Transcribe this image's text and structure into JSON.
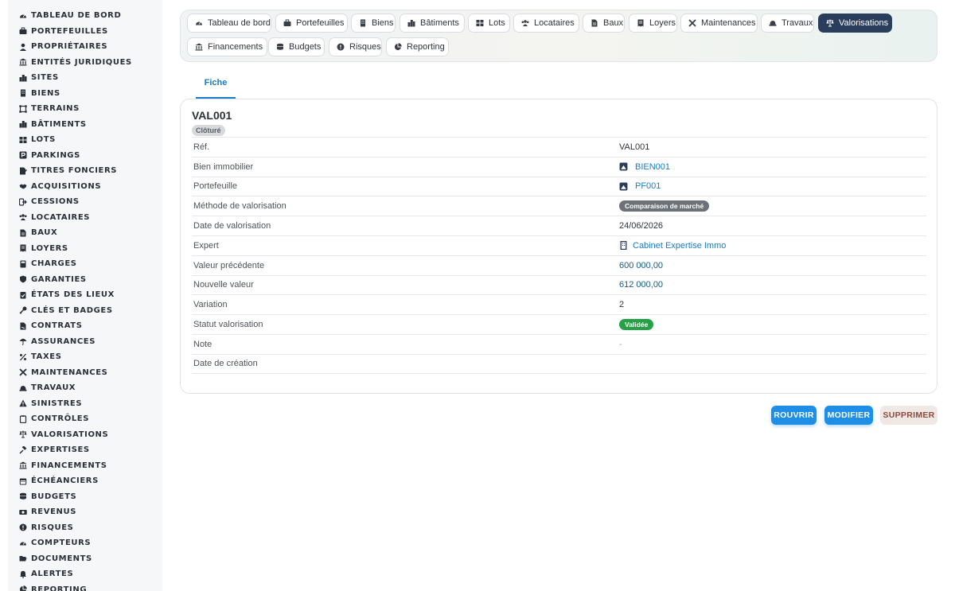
{
  "sidebar": {
    "items": [
      {
        "label": "TABLEAU DE BORD",
        "icon": "gauge-icon"
      },
      {
        "label": "PORTEFEUILLES",
        "icon": "briefcase-icon"
      },
      {
        "label": "PROPRIÉTAIRES",
        "icon": "user-icon"
      },
      {
        "label": "ENTITÉS JURIDIQUES",
        "icon": "landmark-icon"
      },
      {
        "label": "SITES",
        "icon": "city-icon"
      },
      {
        "label": "BIENS",
        "icon": "building-icon"
      },
      {
        "label": "TERRAINS",
        "icon": "vector-square-icon"
      },
      {
        "label": "BÂTIMENTS",
        "icon": "city-icon"
      },
      {
        "label": "LOTS",
        "icon": "grid-icon"
      },
      {
        "label": "PARKINGS",
        "icon": "parking-icon"
      },
      {
        "label": "TITRES FONCIERS",
        "icon": "file-signature-icon"
      },
      {
        "label": "ACQUISITIONS",
        "icon": "handshake-icon"
      },
      {
        "label": "CESSIONS",
        "icon": "sign-out-icon"
      },
      {
        "label": "LOCATAIRES",
        "icon": "users-icon"
      },
      {
        "label": "BAUX",
        "icon": "file-icon"
      },
      {
        "label": "LOYERS",
        "icon": "receipt-icon"
      },
      {
        "label": "CHARGES",
        "icon": "calculator-icon"
      },
      {
        "label": "GARANTIES",
        "icon": "shield-icon"
      },
      {
        "label": "ÉTATS DES LIEUX",
        "icon": "clipboard-check-icon"
      },
      {
        "label": "CLÉS ET BADGES",
        "icon": "key-icon"
      },
      {
        "label": "CONTRATS",
        "icon": "file-contract-icon"
      },
      {
        "label": "ASSURANCES",
        "icon": "umbrella-icon"
      },
      {
        "label": "TAXES",
        "icon": "percent-icon"
      },
      {
        "label": "MAINTENANCES",
        "icon": "tools-icon"
      },
      {
        "label": "TRAVAUX",
        "icon": "hard-hat-icon"
      },
      {
        "label": "SINISTRES",
        "icon": "warning-icon"
      },
      {
        "label": "CONTRÔLES",
        "icon": "clipboard-icon"
      },
      {
        "label": "VALORISATIONS",
        "icon": "scale-icon"
      },
      {
        "label": "EXPERTISES",
        "icon": "gavel-icon"
      },
      {
        "label": "FINANCEMENTS",
        "icon": "landmark-icon"
      },
      {
        "label": "ÉCHÉANCIERS",
        "icon": "calendar-icon"
      },
      {
        "label": "BUDGETS",
        "icon": "coins-icon"
      },
      {
        "label": "REVENUS",
        "icon": "money-bill-icon"
      },
      {
        "label": "RISQUES",
        "icon": "exclamation-circle-icon"
      },
      {
        "label": "COMPTEURS",
        "icon": "gauge-icon"
      },
      {
        "label": "DOCUMENTS",
        "icon": "folder-open-icon"
      },
      {
        "label": "ALERTES",
        "icon": "bell-icon"
      },
      {
        "label": "REPORTING",
        "icon": "chart-pie-icon"
      }
    ]
  },
  "topnav": {
    "items": [
      {
        "label": "Tableau de bord",
        "icon": "gauge-icon",
        "active": false
      },
      {
        "label": "Portefeuilles",
        "icon": "briefcase-icon",
        "active": false
      },
      {
        "label": "Biens",
        "icon": "building-icon",
        "active": false
      },
      {
        "label": "Bâtiments",
        "icon": "city-icon",
        "active": false
      },
      {
        "label": "Lots",
        "icon": "grid-icon",
        "active": false
      },
      {
        "label": "Locataires",
        "icon": "users-icon",
        "active": false
      },
      {
        "label": "Baux",
        "icon": "file-icon",
        "active": false
      },
      {
        "label": "Loyers",
        "icon": "receipt-icon",
        "active": false
      },
      {
        "label": "Maintenances",
        "icon": "tools-icon",
        "active": false
      },
      {
        "label": "Travaux",
        "icon": "hard-hat-icon",
        "active": false
      },
      {
        "label": "Valorisations",
        "icon": "scale-icon",
        "active": true
      },
      {
        "label": "Financements",
        "icon": "landmark-icon",
        "active": false
      },
      {
        "label": "Budgets",
        "icon": "coins-icon",
        "active": false
      },
      {
        "label": "Risques",
        "icon": "exclamation-circle-icon",
        "active": false
      },
      {
        "label": "Reporting",
        "icon": "chart-pie-icon",
        "active": false
      }
    ]
  },
  "tabs": {
    "fiche": "Fiche"
  },
  "record": {
    "title": "VAL001",
    "status": "Clôturé",
    "fields": {
      "ref": {
        "label": "Réf.",
        "value": "VAL001"
      },
      "bien": {
        "label": "Bien immobilier",
        "value": "BIEN001"
      },
      "portefeuille": {
        "label": "Portefeuille",
        "value": "PF001"
      },
      "methode": {
        "label": "Méthode de valorisation",
        "value": "Comparaison de marché"
      },
      "date_valo": {
        "label": "Date de valorisation",
        "value": "24/06/2026"
      },
      "expert": {
        "label": "Expert",
        "value": "Cabinet Expertise Immo"
      },
      "valeur_prec": {
        "label": "Valeur précédente",
        "value": "600 000,00"
      },
      "nouvelle_valeur": {
        "label": "Nouvelle valeur",
        "value": "612 000,00"
      },
      "variation": {
        "label": "Variation",
        "value": "2"
      },
      "statut": {
        "label": "Statut valorisation",
        "value": "Validée"
      },
      "note": {
        "label": "Note",
        "value": "-"
      },
      "date_creation": {
        "label": "Date de création",
        "value": ""
      }
    }
  },
  "actions": {
    "rouvrir": "ROUVRIR",
    "modifier": "MODIFIER",
    "supprimer": "SUPPRIMER"
  },
  "colors": {
    "accent": "#1a7bc4",
    "active_nav": "#2b3d5c",
    "primary_button": "#1f8ee6",
    "success": "#27a146"
  }
}
